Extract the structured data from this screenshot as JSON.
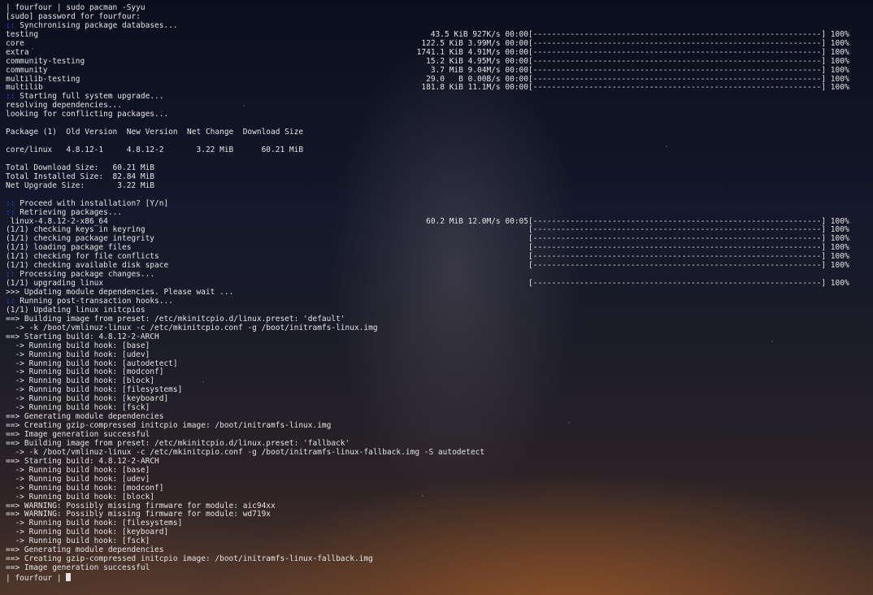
{
  "terminal": {
    "prompt_initial": "| fourfour | sudo pacman -Syyu",
    "sudo_prompt": "[sudo] password for fourfour:",
    "sync_header": "Synchronising package databases...",
    "databases": [
      {
        "name": "testing",
        "size": "43.5 KiB",
        "speed": "927K/s",
        "time": "00:00",
        "bar": "[--------------------------------------------------------------]",
        "percent": "100%"
      },
      {
        "name": "core",
        "size": "122.5 KiB",
        "speed": "3.99M/s",
        "time": "00:00",
        "bar": "[--------------------------------------------------------------]",
        "percent": "100%"
      },
      {
        "name": "extra",
        "size": "1741.1 KiB",
        "speed": "4.91M/s",
        "time": "00:00",
        "bar": "[--------------------------------------------------------------]",
        "percent": "100%"
      },
      {
        "name": "community-testing",
        "size": "15.2 KiB",
        "speed": "4.95M/s",
        "time": "00:00",
        "bar": "[--------------------------------------------------------------]",
        "percent": "100%"
      },
      {
        "name": "community",
        "size": "3.7 MiB",
        "speed": "9.04M/s",
        "time": "00:00",
        "bar": "[--------------------------------------------------------------]",
        "percent": "100%"
      },
      {
        "name": "multilib-testing",
        "size": "29.0   B",
        "speed": "0.00B/s",
        "time": "00:00",
        "bar": "[--------------------------------------------------------------]",
        "percent": "100%"
      },
      {
        "name": "multilib",
        "size": "181.8 KiB",
        "speed": "11.1M/s",
        "time": "00:00",
        "bar": "[--------------------------------------------------------------]",
        "percent": "100%"
      }
    ],
    "upgrade_header": "Starting full system upgrade...",
    "resolving": "resolving dependencies...",
    "conflicts": "looking for conflicting packages...",
    "table_header": "Package (1)  Old Version  New Version  Net Change  Download Size",
    "table_row": "core/linux   4.8.12-1     4.8.12-2       3.22 MiB      60.21 MiB",
    "total_download": "Total Download Size:   60.21 MiB",
    "total_installed": "Total Installed Size:  82.84 MiB",
    "net_upgrade": "Net Upgrade Size:       3.22 MiB",
    "proceed": "Proceed with installation? [Y/n]",
    "retrieving": "Retrieving packages...",
    "download": {
      "name": "linux-4.8.12-2-x86_64",
      "size": "60.2 MiB",
      "speed": "12.0M/s",
      "time": "00:05",
      "bar": "[--------------------------------------------------------------]",
      "percent": "100%"
    },
    "checks": [
      {
        "text": "(1/1) checking keys in keyring",
        "bar": "[--------------------------------------------------------------]",
        "percent": "100%"
      },
      {
        "text": "(1/1) checking package integrity",
        "bar": "[--------------------------------------------------------------]",
        "percent": "100%"
      },
      {
        "text": "(1/1) loading package files",
        "bar": "[--------------------------------------------------------------]",
        "percent": "100%"
      },
      {
        "text": "(1/1) checking for file conflicts",
        "bar": "[--------------------------------------------------------------]",
        "percent": "100%"
      },
      {
        "text": "(1/1) checking available disk space",
        "bar": "[--------------------------------------------------------------]",
        "percent": "100%"
      }
    ],
    "processing": "Processing package changes...",
    "upgrading": {
      "text": "(1/1) upgrading linux",
      "bar": "[--------------------------------------------------------------]",
      "percent": "100%"
    },
    "module_deps": ">>> Updating module dependencies. Please wait ...",
    "post_hooks": "Running post-transaction hooks...",
    "initcpio_update": "(1/1) Updating linux initcpios",
    "build_lines": [
      "==> Building image from preset: /etc/mkinitcpio.d/linux.preset: 'default'",
      "  -> -k /boot/vmlinuz-linux -c /etc/mkinitcpio.conf -g /boot/initramfs-linux.img",
      "==> Starting build: 4.8.12-2-ARCH",
      "  -> Running build hook: [base]",
      "  -> Running build hook: [udev]",
      "  -> Running build hook: [autodetect]",
      "  -> Running build hook: [modconf]",
      "  -> Running build hook: [block]",
      "  -> Running build hook: [filesystems]",
      "  -> Running build hook: [keyboard]",
      "  -> Running build hook: [fsck]",
      "==> Generating module dependencies",
      "==> Creating gzip-compressed initcpio image: /boot/initramfs-linux.img",
      "==> Image generation successful",
      "==> Building image from preset: /etc/mkinitcpio.d/linux.preset: 'fallback'",
      "  -> -k /boot/vmlinuz-linux -c /etc/mkinitcpio.conf -g /boot/initramfs-linux-fallback.img -S autodetect",
      "==> Starting build: 4.8.12-2-ARCH",
      "  -> Running build hook: [base]",
      "  -> Running build hook: [udev]",
      "  -> Running build hook: [modconf]",
      "  -> Running build hook: [block]",
      "==> WARNING: Possibly missing firmware for module: aic94xx",
      "==> WARNING: Possibly missing firmware for module: wd719x",
      "  -> Running build hook: [filesystems]",
      "  -> Running build hook: [keyboard]",
      "  -> Running build hook: [fsck]",
      "==> Generating module dependencies",
      "==> Creating gzip-compressed initcpio image: /boot/initramfs-linux-fallback.img",
      "==> Image generation successful"
    ],
    "prompt_final": "| fourfour | ",
    "marker": "::"
  },
  "colors": {
    "text": "#e4e4e4",
    "marker": "#2f4cff"
  }
}
